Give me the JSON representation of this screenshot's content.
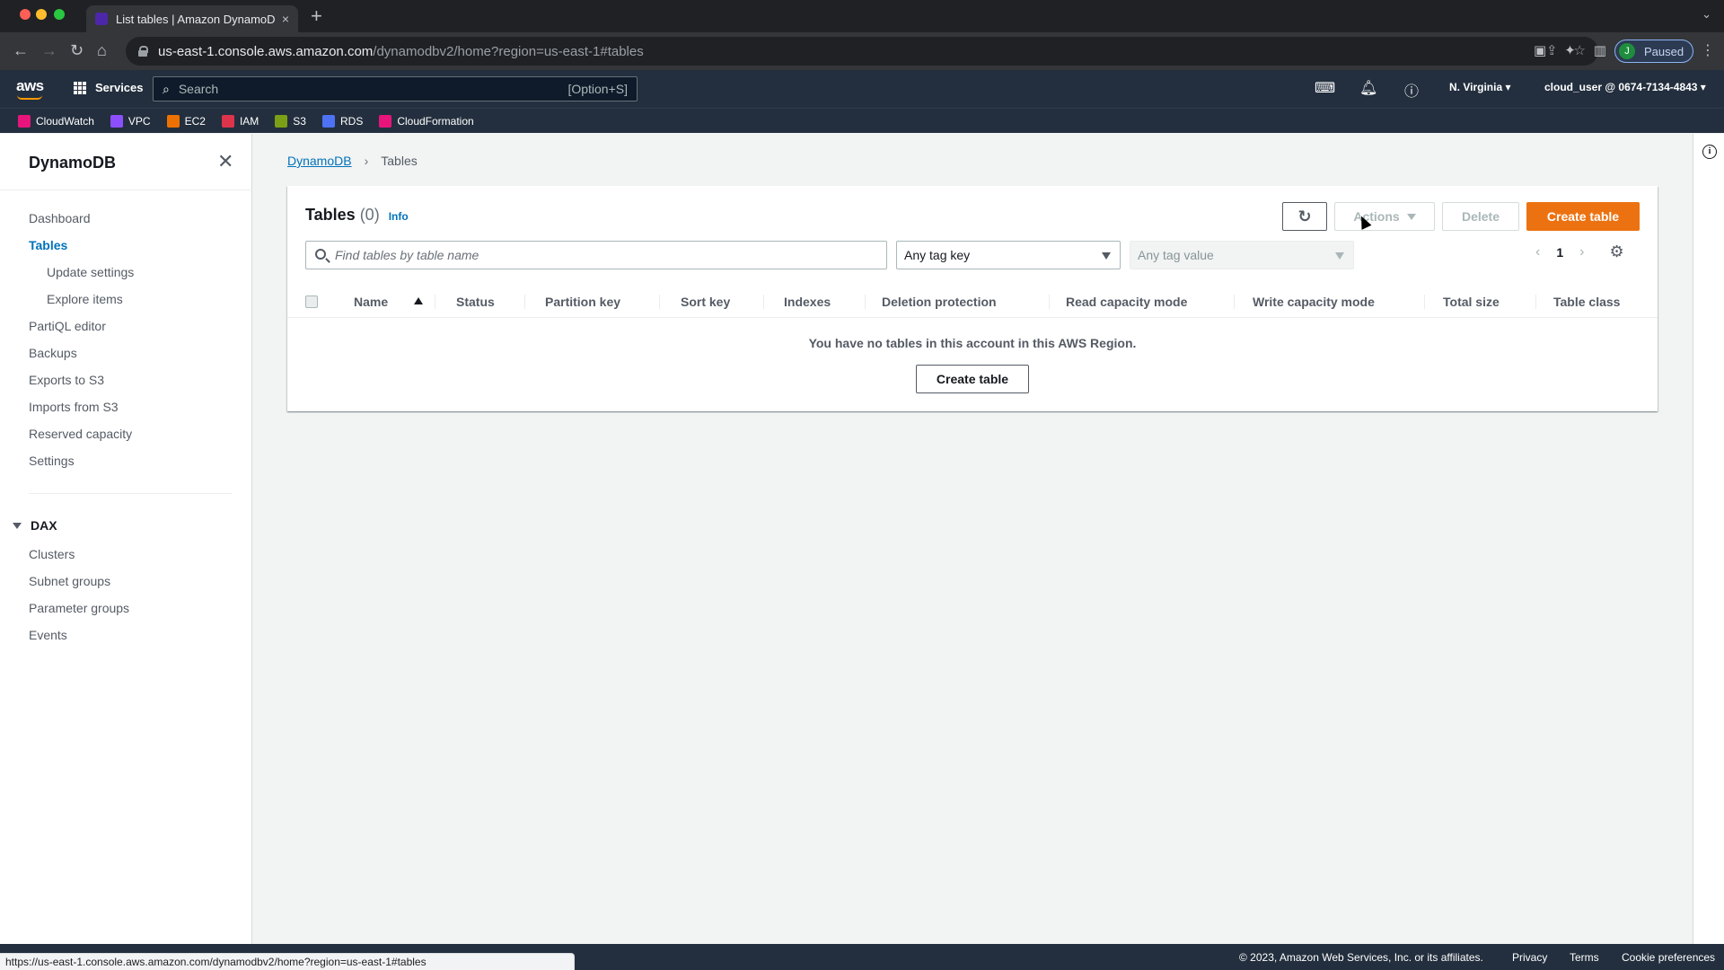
{
  "browser": {
    "tab_title": "List tables | Amazon DynamoD",
    "tab_close": "×",
    "new_tab": "+",
    "url_host": "us-east-1.console.aws.amazon.com",
    "url_path": "/dynamodbv2/home?region=us-east-1#tables",
    "profile_initial": "J",
    "profile_status": "Paused",
    "hover_url": "https://us-east-1.console.aws.amazon.com/dynamodbv2/home?region=us-east-1#tables"
  },
  "aws_nav": {
    "logo": "aws",
    "services_label": "Services",
    "search_placeholder": "Search",
    "search_shortcut": "[Option+S]",
    "region": "N. Virginia ▾",
    "account": "cloud_user @ 0674-7134-4843 ▾",
    "favorites": [
      {
        "label": "CloudWatch",
        "color": "#e7157b"
      },
      {
        "label": "VPC",
        "color": "#8c4fff"
      },
      {
        "label": "EC2",
        "color": "#ed7100"
      },
      {
        "label": "IAM",
        "color": "#dd344c"
      },
      {
        "label": "S3",
        "color": "#7aa116"
      },
      {
        "label": "RDS",
        "color": "#4d72f3"
      },
      {
        "label": "CloudFormation",
        "color": "#e7157b"
      }
    ]
  },
  "sidebar": {
    "title": "DynamoDB",
    "items": [
      {
        "label": "Dashboard"
      },
      {
        "label": "Tables"
      },
      {
        "label": "Update settings"
      },
      {
        "label": "Explore items"
      },
      {
        "label": "PartiQL editor"
      },
      {
        "label": "Backups"
      },
      {
        "label": "Exports to S3"
      },
      {
        "label": "Imports from S3"
      },
      {
        "label": "Reserved capacity"
      },
      {
        "label": "Settings"
      }
    ],
    "dax": {
      "header": "DAX",
      "items": [
        {
          "label": "Clusters"
        },
        {
          "label": "Subnet groups"
        },
        {
          "label": "Parameter groups"
        },
        {
          "label": "Events"
        }
      ]
    }
  },
  "breadcrumb": {
    "root": "DynamoDB",
    "current": "Tables"
  },
  "tables_panel": {
    "title": "Tables",
    "count": "(0)",
    "info": "Info",
    "actions_label": "Actions",
    "delete_label": "Delete",
    "create_label": "Create table",
    "search_placeholder": "Find tables by table name",
    "tag_key": "Any tag key",
    "tag_value": "Any tag value",
    "page": "1",
    "columns": [
      "Name",
      "Status",
      "Partition key",
      "Sort key",
      "Indexes",
      "Deletion protection",
      "Read capacity mode",
      "Write capacity mode",
      "Total size",
      "Table class"
    ],
    "empty_message": "You have no tables in this account in this AWS Region.",
    "empty_create_label": "Create table"
  },
  "footer": {
    "copyright": "© 2023, Amazon Web Services, Inc. or its affiliates.",
    "privacy": "Privacy",
    "terms": "Terms",
    "cookies": "Cookie preferences"
  },
  "colors": {
    "primary_button": "#ec7211",
    "link": "#0073bb",
    "nav_bg": "#232f3e"
  }
}
